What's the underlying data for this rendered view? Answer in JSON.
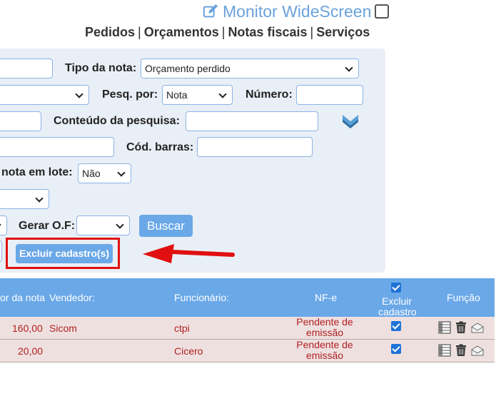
{
  "header": {
    "monitor_label": "Monitor WideScreen",
    "nav": [
      "Pedidos",
      "Orçamentos",
      "Notas fiscais",
      "Serviços"
    ],
    "nav_separator": "|"
  },
  "filters": {
    "tipo_nota_label": "Tipo da nota:",
    "tipo_nota_value": "Orçamento perdido",
    "pesq_por_label": "Pesq. por:",
    "pesq_por_value": "Nota",
    "numero_label": "Número:",
    "conteudo_label": "Conteúdo da pesquisa:",
    "cod_barras_label": "Cód. barras:",
    "nota_lote_label": "nota em lote:",
    "nota_lote_value": "Não",
    "gerar_of_label": "Gerar O.F:",
    "gerar_of_value": ""
  },
  "buttons": {
    "buscar": "Buscar",
    "excluir_cadastros": "Excluir cadastro(s)"
  },
  "table": {
    "columns": {
      "valor": "or da nota",
      "vendedor": "Vendedor:",
      "funcionario": "Funcionário:",
      "nfe": "NF-e",
      "excluir_l1": "Excluir",
      "excluir_l2": "cadastro",
      "funcao": "Função"
    },
    "rows": [
      {
        "valor": "160,00",
        "vendedor": "Sicom",
        "funcionario": "ctpi",
        "nfe_l1": "Pendente de",
        "nfe_l2": "emissão",
        "excluir_checked": true
      },
      {
        "valor": "20,00",
        "vendedor": "",
        "funcionario": "Cicero",
        "nfe_l1": "Pendente de",
        "nfe_l2": "emissão",
        "excluir_checked": true
      }
    ],
    "row_icons": [
      "table-icon",
      "trash-icon",
      "envelope-icon"
    ]
  },
  "colors": {
    "accent": "#6aa8e8",
    "panel_bg": "#e9eff6",
    "row_bg": "#efe0e0",
    "row_text": "#b02020",
    "annotation_red": "#e01010"
  }
}
